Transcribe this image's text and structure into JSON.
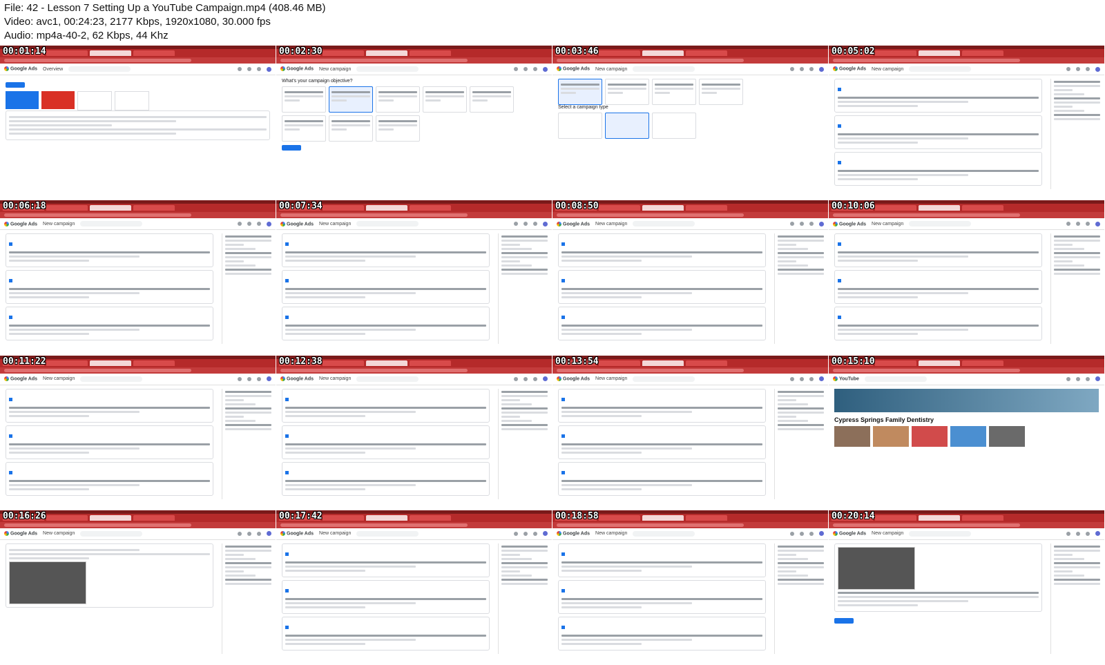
{
  "file_info": {
    "file_line": "File: 42 - Lesson 7 Setting Up a YouTube Campaign.mp4 (408.46 MB)",
    "video_line": "Video: avc1, 00:24:23, 2177 Kbps, 1920x1080, 30.000 fps",
    "audio_line": "Audio: mp4a-40-2, 62 Kbps, 44 Khz"
  },
  "app": {
    "brand": "Google Ads",
    "page_overview": "Overview",
    "page_new_campaign": "New campaign",
    "objective_question": "What's your campaign objective?",
    "campaign_type_label": "Select a campaign type",
    "youtube_channel_name": "Cypress Springs Family Dentistry",
    "youtube_brand": "YouTube"
  },
  "thumbnails": [
    {
      "time": "00:01:14",
      "view": "overview",
      "page_title": "app.page_overview"
    },
    {
      "time": "00:02:30",
      "view": "objective"
    },
    {
      "time": "00:03:46",
      "view": "campaign-type"
    },
    {
      "time": "00:05:02",
      "view": "settings"
    },
    {
      "time": "00:06:18",
      "view": "settings"
    },
    {
      "time": "00:07:34",
      "view": "settings"
    },
    {
      "time": "00:08:50",
      "view": "settings"
    },
    {
      "time": "00:10:06",
      "view": "settings"
    },
    {
      "time": "00:11:22",
      "view": "settings"
    },
    {
      "time": "00:12:38",
      "view": "settings"
    },
    {
      "time": "00:13:54",
      "view": "settings"
    },
    {
      "time": "00:15:10",
      "view": "youtube"
    },
    {
      "time": "00:16:26",
      "view": "video-ad"
    },
    {
      "time": "00:17:42",
      "view": "settings"
    },
    {
      "time": "00:18:58",
      "view": "settings"
    },
    {
      "time": "00:20:14",
      "view": "bid"
    }
  ],
  "colors": {
    "chrome_red": "#b52a2a",
    "accent_blue": "#1a73e8",
    "alert_red": "#d93025"
  }
}
